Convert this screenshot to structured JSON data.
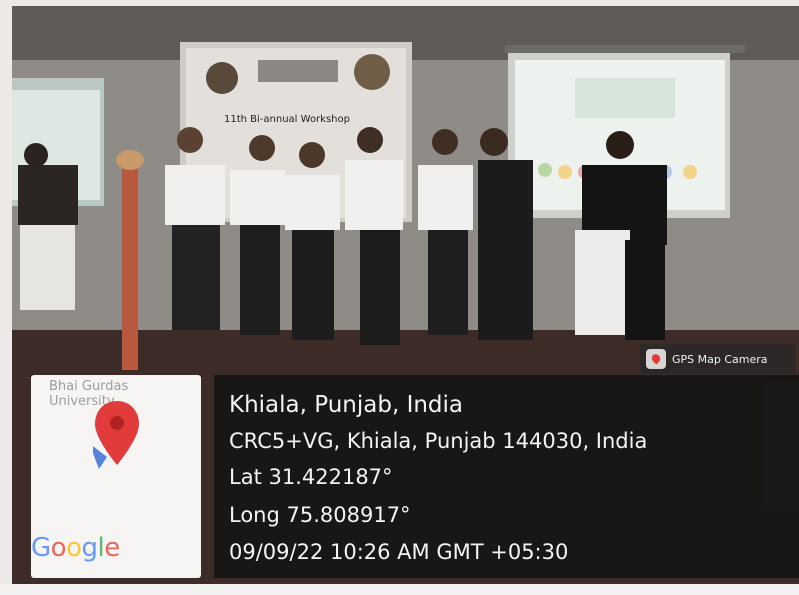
{
  "camera_badge": {
    "label": "GPS Map Camera",
    "icon": "gps-map-camera-icon"
  },
  "map_thumbnail": {
    "partial_text": "Bhai Gurdas\nUniversity",
    "logo_text": "Google",
    "pin_color": "#e23b3b"
  },
  "location_info": {
    "place": "Khiala, Punjab, India",
    "address": "CRC5+VG, Khiala, Punjab 144030, India",
    "latitude": "Lat 31.422187°",
    "longitude": "Long 75.808917°",
    "datetime": "09/09/22 10:26 AM GMT +05:30"
  },
  "scene": {
    "banner_heading": "11th Bi-annual Workshop",
    "colors": {
      "overlay": "#161616",
      "text": "#f4f4f4"
    }
  }
}
